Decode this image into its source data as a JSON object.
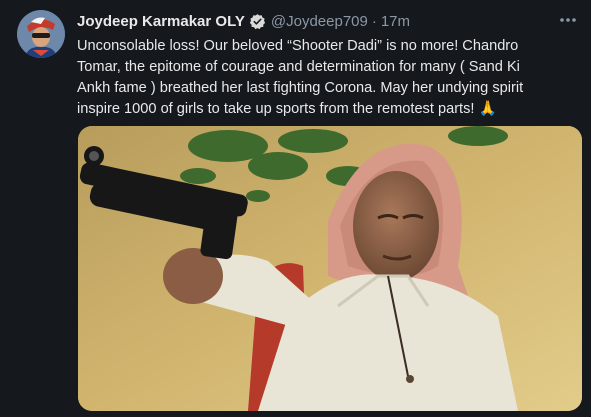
{
  "tweet": {
    "author_name": "Joydeep Karmakar OLY",
    "handle": "@Joydeep709",
    "separator": "·",
    "time": "17m",
    "text": "Unconsolable loss! Our beloved “Shooter Dadi” is no more! Chandro\nTomar, the epitome of courage and determination for many ( Sand Ki\nAnkh fame ) breathed her last fighting Corona. May her undying spirit\ninspire 1000 of girls to take up sports from the remotest parts! 🙏",
    "icons": [
      "avatar",
      "verified-badge-icon",
      "more-options-icon"
    ],
    "media": "photo-elderly-woman-aiming-air-pistol"
  },
  "colors": {
    "background": "#15181c",
    "text_primary": "#e7e9ea",
    "text_secondary": "#8b98a5",
    "verified_badge": "#d9d9d9"
  }
}
